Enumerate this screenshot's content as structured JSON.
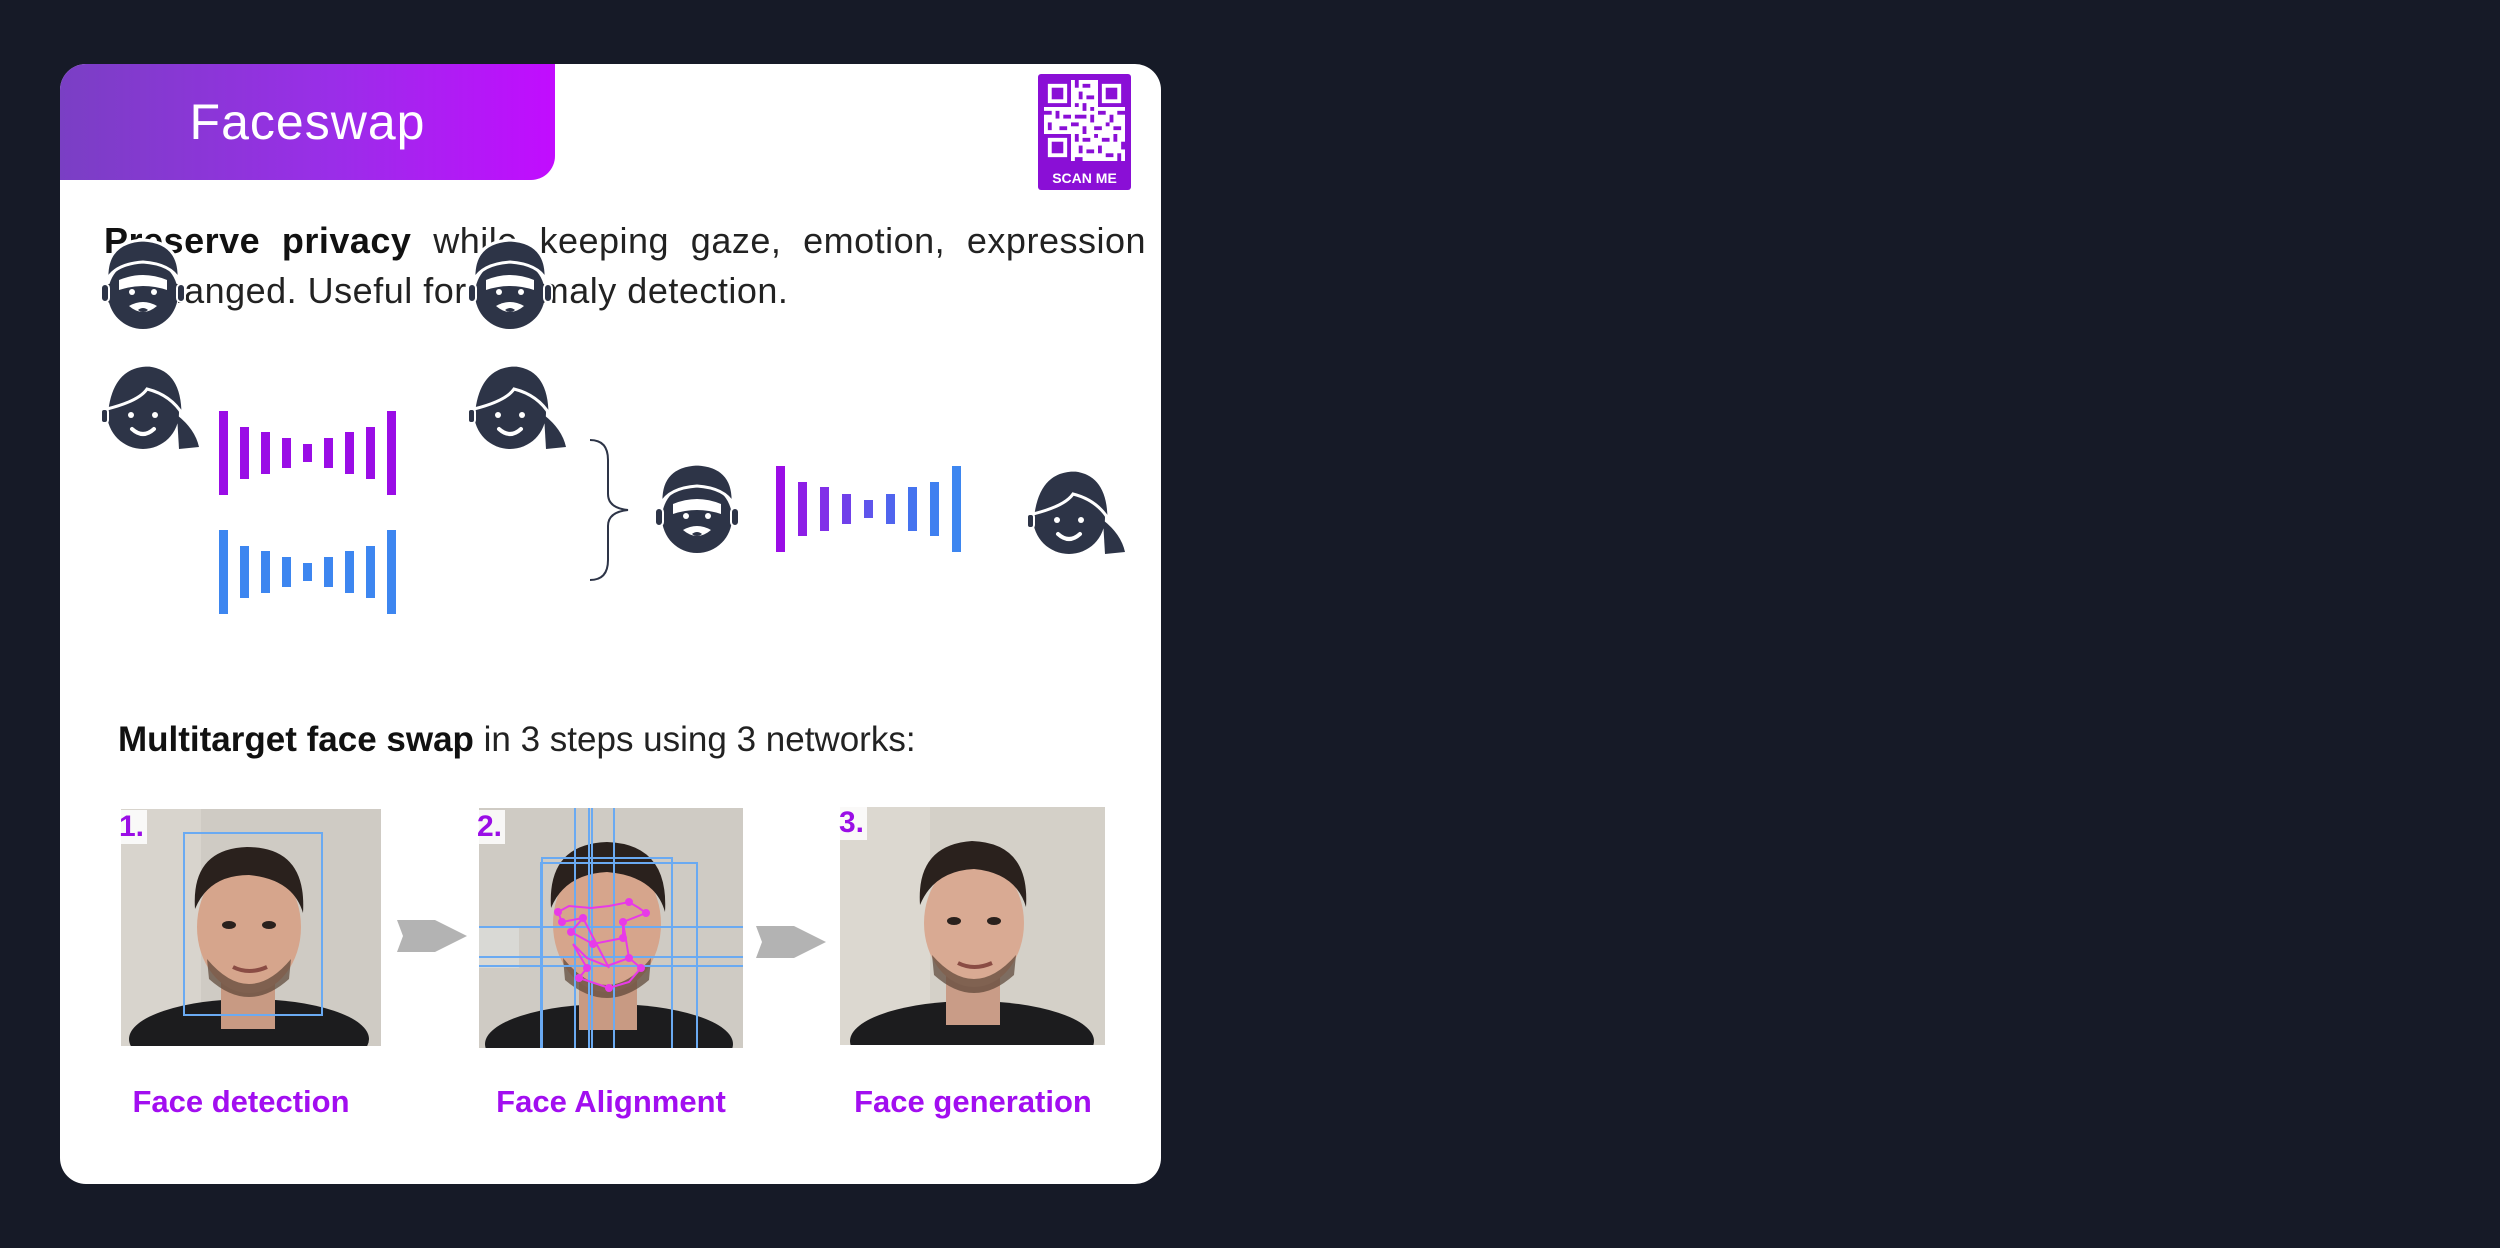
{
  "header": {
    "title": "Faceswap"
  },
  "qr": {
    "label": "SCAN ME"
  },
  "intro": {
    "bold": "Preserve privacy",
    "text": " while keeping gaze, emotion, expression unchanged. Useful for anomaly detection."
  },
  "section": {
    "bold": "Multitarget face swap",
    "text": " in 3 steps using 3 networks:"
  },
  "steps": [
    {
      "number": "1.",
      "label": "Face detection"
    },
    {
      "number": "2.",
      "label": "Face Alignment"
    },
    {
      "number": "3.",
      "label": "Face generation"
    }
  ],
  "colors": {
    "purple": "#9a0de6",
    "blue": "#3d86f0",
    "face": "#2d3447",
    "arrow": "#b3b3b3"
  }
}
